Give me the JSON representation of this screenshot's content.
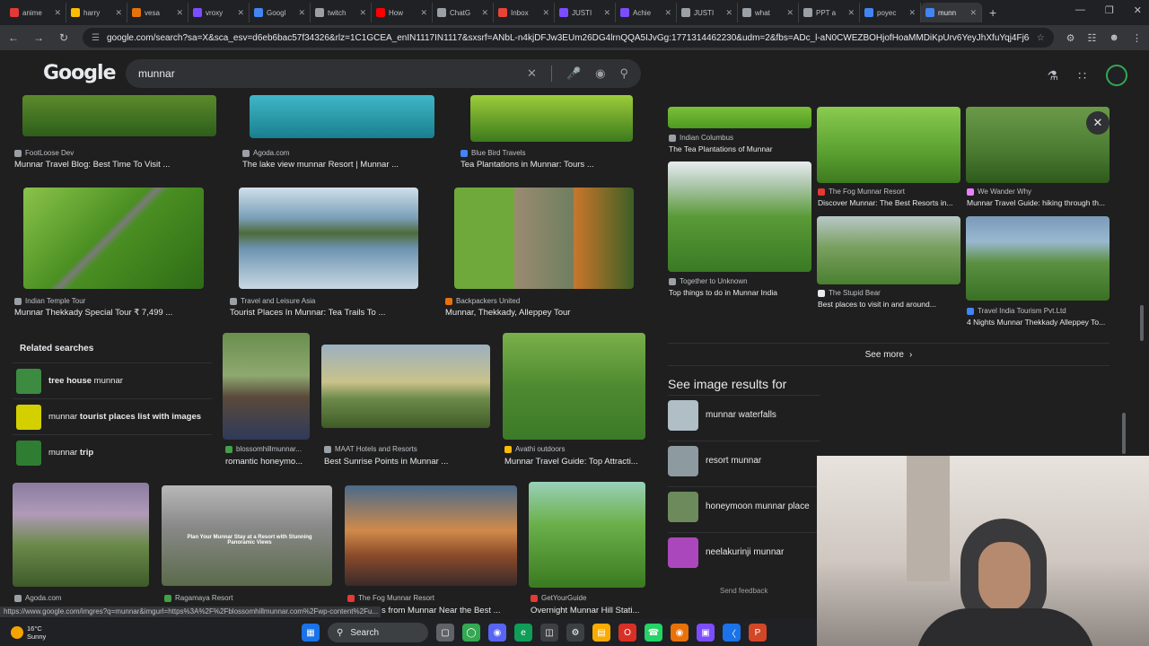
{
  "browser": {
    "tabs": [
      {
        "label": "anime",
        "color": "#e53935"
      },
      {
        "label": "harry",
        "color": "#fbbc04"
      },
      {
        "label": "vesa",
        "color": "#e8710a"
      },
      {
        "label": "vroxy",
        "color": "#7c4dff"
      },
      {
        "label": "Googl",
        "color": "#4285f4"
      },
      {
        "label": "twitch",
        "color": "#9aa0a6"
      },
      {
        "label": "How",
        "color": "#ff0000"
      },
      {
        "label": "ChatG",
        "color": "#9aa0a6"
      },
      {
        "label": "Inbox",
        "color": "#ea4335"
      },
      {
        "label": "JUSTI",
        "color": "#7c4dff"
      },
      {
        "label": "Achie",
        "color": "#7c4dff"
      },
      {
        "label": "JUSTI",
        "color": "#9aa0a6"
      },
      {
        "label": "what",
        "color": "#9aa0a6"
      },
      {
        "label": "PPT a",
        "color": "#9aa0a6"
      },
      {
        "label": "poyec",
        "color": "#4285f4"
      },
      {
        "label": "munn",
        "color": "#4285f4"
      }
    ],
    "url": "google.com/search?sa=X&sca_esv=d6eb6bac57f34326&rlz=1C1GCEA_enIN1117IN1117&sxsrf=ANbL-n4kjDFJw3EUm26DG4lrnQQA5IJvGg:1771314462230&udm=2&fbs=ADc_l-aN0CWEZBOHjofHoaMMDiKpUrv6YeyJhXfuYqj4Fj6c1UM_gfiPu45LsYickL...",
    "status_url": "https://www.google.com/imgres?q=munnar&imgurl=https%3A%2F%2Fblossomhillmunnar.com%2Fwp-content%2Fu..."
  },
  "search": {
    "logo": "Google",
    "query": "munnar"
  },
  "results_row1": [
    {
      "source": "FootLoose Dev",
      "title": "Munnar Travel Blog: Best Time To Visit ...",
      "fav": "#9aa0a6"
    },
    {
      "source": "Agoda.com",
      "title": "The lake view munnar Resort | Munnar ...",
      "fav": "#9aa0a6"
    },
    {
      "source": "Blue Bird Travels",
      "title": "Tea Plantations in Munnar: Tours ...",
      "fav": "#4285f4"
    }
  ],
  "results_row2": [
    {
      "source": "Indian Temple Tour",
      "title": "Munnar Thekkady Special Tour ₹ 7,499 ...",
      "fav": "#9aa0a6"
    },
    {
      "source": "Travel and Leisure Asia",
      "title": "Tourist Places In Munnar: Tea Trails To ...",
      "fav": "#9aa0a6"
    },
    {
      "source": "Backpackers United",
      "title": "Munnar, Thekkady, Alleppey Tour",
      "fav": "#e8710a"
    }
  ],
  "related": {
    "heading": "Related searches",
    "items": [
      {
        "pre": "tree house",
        "post": " munnar",
        "color": "#3d8b40"
      },
      {
        "pre": "munnar ",
        "post": "tourist places list with images",
        "color": "#d4d000"
      },
      {
        "pre": "munnar ",
        "post": "trip",
        "color": "#2e7d32"
      }
    ]
  },
  "results_row3": [
    {
      "source": "blossomhillmunnar...",
      "title": "romantic honeymo...",
      "fav": "#43a047"
    },
    {
      "source": "MAAT Hotels and Resorts",
      "title": "Best Sunrise Points in Munnar ...",
      "fav": "#9aa0a6"
    },
    {
      "source": "Avathi outdoors",
      "title": "Munnar Travel Guide: Top Attracti...",
      "fav": "#fbbc04"
    }
  ],
  "results_row4": [
    {
      "source": "Agoda.com",
      "title": "",
      "fav": "#9aa0a6"
    },
    {
      "source": "Ragamaya Resort",
      "title": "",
      "fav": "#43a047"
    },
    {
      "source": "The Fog Munnar Resort",
      "title": "s from Munnar Near the Best ...",
      "fav": "#e53935"
    },
    {
      "source": "GetYourGuide",
      "title": "Overnight Munnar Hill Stati...",
      "fav": "#e53935"
    }
  ],
  "ragamaya_overlay": "Plan Your Munnar Stay at a Resort with Stunning Panoramic Views",
  "panel": {
    "items": [
      {
        "source": "Indian Columbus",
        "title": "The Tea Plantations of Munnar",
        "fav": "#9aa0a6"
      },
      {
        "source": "The Fog Munnar Resort",
        "title": "Discover Munnar: The Best Resorts in...",
        "fav": "#e53935"
      },
      {
        "source": "We Wander Why",
        "title": "Munnar Travel Guide: hiking through th...",
        "fav": "#ea80fc"
      },
      {
        "source": "Together to Unknown",
        "title": "Top things to do in Munnar India",
        "fav": "#9aa0a6"
      },
      {
        "source": "The Stupid Bear",
        "title": "Best places to visit in and around...",
        "fav": "#e8eaed"
      },
      {
        "source": "Travel India Tourism Pvt.Ltd",
        "title": "4 Nights Munnar Thekkady Alleppey To...",
        "fav": "#4285f4"
      }
    ],
    "see_more": "See more",
    "see_image_results": "See image results for",
    "image_results": [
      {
        "label": "munnar waterfalls",
        "color": "#b0bec5"
      },
      {
        "label": "resort munnar",
        "color": "#8d9aa0"
      },
      {
        "label": "honeymoon munnar place",
        "color": "#6d8a5d"
      },
      {
        "label": "neelakurinji munnar",
        "color": "#ab47bc"
      }
    ],
    "feedback": "Send feedback"
  },
  "taskbar": {
    "temp": "16°C",
    "condition": "Sunny",
    "search": "Search"
  }
}
